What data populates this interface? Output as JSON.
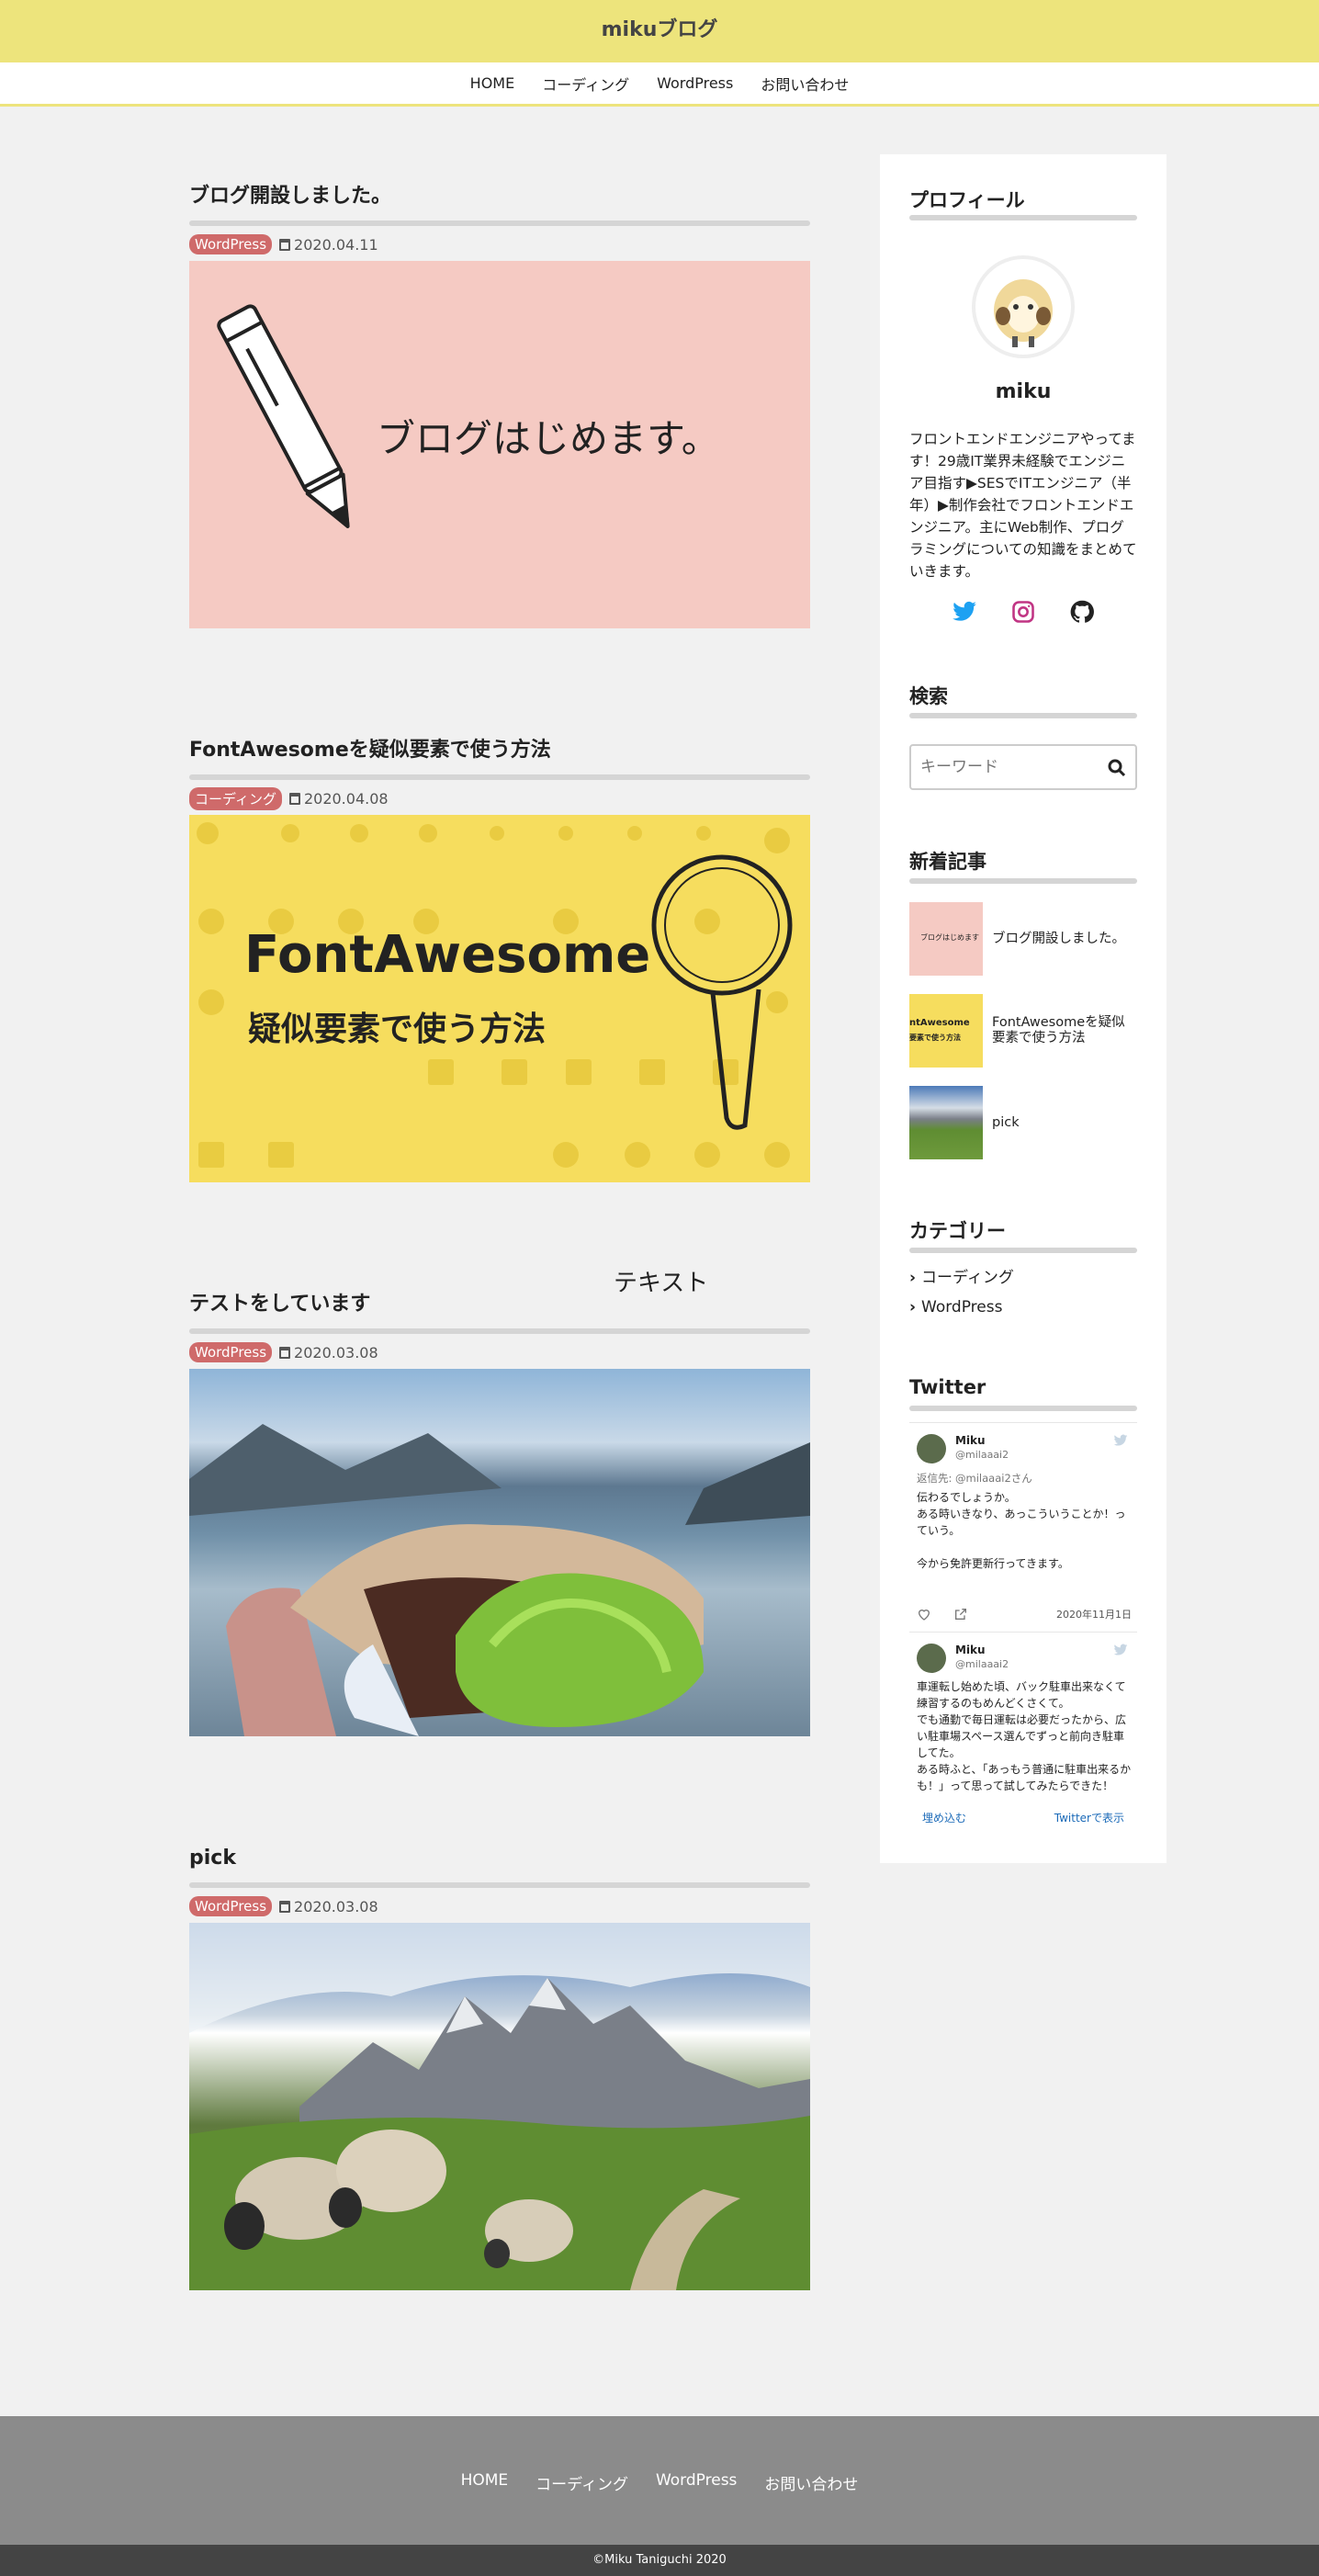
{
  "site": {
    "title": "mikuブログ"
  },
  "nav": [
    "HOME",
    "コーディング",
    "WordPress",
    "お問い合わせ"
  ],
  "floating_text": "テキスト",
  "articles": [
    {
      "title": "ブログ開設しました。",
      "category": "WordPress",
      "date": "2020.04.11",
      "image_text": "ブログはじめます。"
    },
    {
      "title": "FontAwesomeを疑似要素で使う方法",
      "category": "コーディング",
      "date": "2020.04.08",
      "image_text_1": "FontAwesome",
      "image_text_2": "疑似要素で使う方法"
    },
    {
      "title": "テストをしています",
      "category": "WordPress",
      "date": "2020.03.08"
    },
    {
      "title": "pick",
      "category": "WordPress",
      "date": "2020.03.08"
    }
  ],
  "sidebar": {
    "profile": {
      "heading": "プロフィール",
      "name": "miku",
      "text": "フロントエンドエンジニアやってます！29歳IT業界未経験でエンジニア目指す▶SESでITエンジニア（半年）▶制作会社でフロントエンドエンジニア。主にWeb制作、プログラミングについての知識をまとめていきます。",
      "social_icons": [
        "twitter-icon",
        "instagram-icon",
        "github-icon"
      ]
    },
    "search": {
      "heading": "検索",
      "placeholder": "キーワード"
    },
    "recent": {
      "heading": "新着記事",
      "items": [
        {
          "title": "ブログ開設しました。",
          "thumb_text": "ブログはじめます"
        },
        {
          "title": "FontAwesomeを疑似要素で使う方法",
          "thumb_text_1": "ntAwesome",
          "thumb_text_2": "要素で使う方法"
        },
        {
          "title": "pick"
        }
      ]
    },
    "categories": {
      "heading": "カテゴリー",
      "items": [
        "コーディング",
        "WordPress"
      ]
    },
    "twitter": {
      "heading": "Twitter",
      "tweets": [
        {
          "name": "Miku",
          "handle": "@milaaai2",
          "reply": "返信先: @milaaai2さん",
          "body": "伝わるでしょうか。\nある時いきなり、あっこういうことか！っていう。\n\n今から免許更新行ってきます。",
          "date": "2020年11月1日"
        },
        {
          "name": "Miku",
          "handle": "@milaaai2",
          "body": "車運転し始めた頃、バック駐車出来なくて練習するのもめんどくさくて。\nでも通勤で毎日運転は必要だったから、広い駐車場スペース選んでずっと前向き駐車してた。\nある時ふと、「あっもう普通に駐車出来るかも！」って思って試してみたらできた！"
        }
      ],
      "embed_label": "埋め込む",
      "view_label": "Twitterで表示"
    }
  },
  "footer": {
    "nav": [
      "HOME",
      "コーディング",
      "WordPress",
      "お問い合わせ"
    ],
    "copyright": "©Miku Taniguchi 2020"
  },
  "colors": {
    "header_bg": "#ede47c",
    "badge": "#cf6a6a",
    "footer_bg": "#8b8b8b",
    "copyright_bg": "#444444",
    "twitter": "#1da1f2",
    "instagram": "#c13584"
  }
}
